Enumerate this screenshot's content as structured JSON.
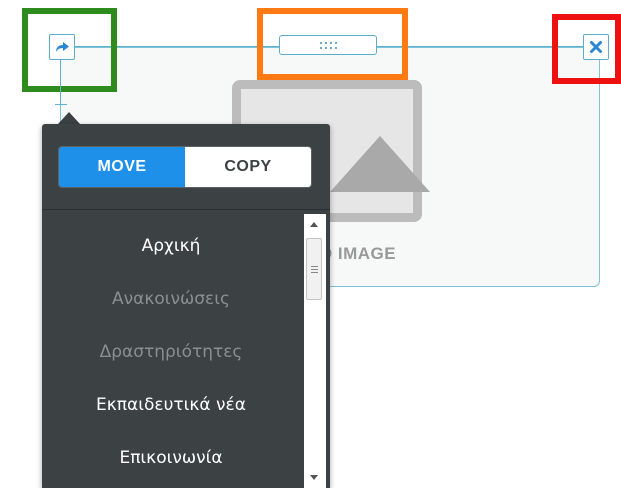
{
  "toolbar": {
    "move_icon": "arrow-right-icon",
    "drag_icon": "grip-dots-icon",
    "close_icon": "close-icon"
  },
  "placeholder": {
    "label": "D IMAGE"
  },
  "move_panel": {
    "move_label": "MOVE",
    "copy_label": "COPY",
    "selected_mode": "MOVE",
    "pages": [
      {
        "label": "Αρχική",
        "state": "active"
      },
      {
        "label": "Ανακοινώσεις",
        "state": "muted"
      },
      {
        "label": "Δραστηριότητες",
        "state": "muted"
      },
      {
        "label": "Εκπαιδευτικά νέα",
        "state": "active"
      },
      {
        "label": "Επικοινωνία",
        "state": "active"
      }
    ]
  },
  "colors": {
    "accent": "#1f90e9",
    "panel_bg": "#3c4144",
    "handle_border": "#5aaec8",
    "highlight_green": "#2e8b1e",
    "highlight_orange": "#ff7a12",
    "highlight_red": "#ee1111"
  }
}
